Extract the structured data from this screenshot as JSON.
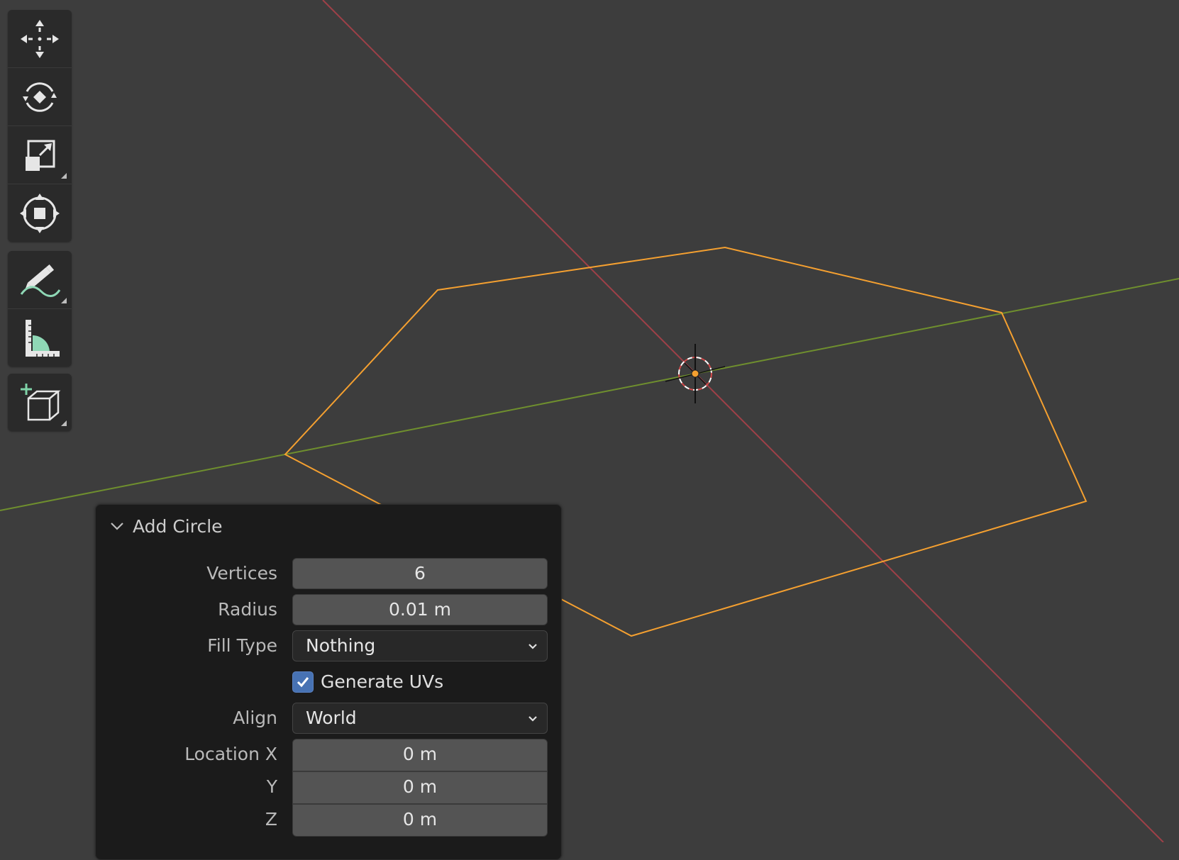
{
  "viewport": {
    "background_color": "#3d3d3d",
    "x_axis_color": "#9e4048",
    "y_axis_color": "#6f8f2e",
    "selection_color": "#f5a030"
  },
  "toolbar": {
    "tools": [
      {
        "id": "move",
        "icon": "move-icon"
      },
      {
        "id": "rotate",
        "icon": "rotate-icon"
      },
      {
        "id": "scale",
        "icon": "scale-icon",
        "has_submenu": true
      },
      {
        "id": "transform",
        "icon": "transform-icon"
      },
      {
        "id": "annotate",
        "icon": "annotate-icon",
        "has_submenu": true
      },
      {
        "id": "measure",
        "icon": "measure-icon"
      },
      {
        "id": "add-cube",
        "icon": "add-cube-icon",
        "has_submenu": true
      }
    ]
  },
  "panel": {
    "title": "Add Circle",
    "collapsed": false,
    "vertices": {
      "label": "Vertices",
      "value": "6"
    },
    "radius": {
      "label": "Radius",
      "value": "0.01 m"
    },
    "fill_type": {
      "label": "Fill Type",
      "value": "Nothing"
    },
    "generate_uvs": {
      "label": "Generate UVs",
      "checked": true
    },
    "align": {
      "label": "Align",
      "value": "World"
    },
    "location_x": {
      "label": "Location X",
      "value": "0 m"
    },
    "location_y": {
      "label": "Y",
      "value": "0 m"
    },
    "location_z": {
      "label": "Z",
      "value": "0 m"
    }
  }
}
